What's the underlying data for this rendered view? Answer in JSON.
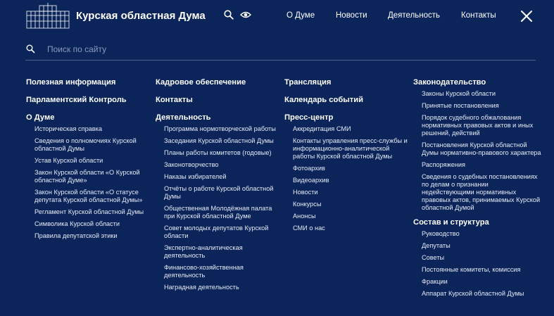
{
  "header": {
    "site_title": "Курская областная Дума",
    "nav": [
      "О Думе",
      "Новости",
      "Деятельность",
      "Контакты"
    ]
  },
  "search": {
    "placeholder": "Поиск по сайту"
  },
  "icons": {
    "search": "search-icon",
    "accessibility": "eye-icon",
    "close": "close-icon",
    "logo": "duma-building-logo"
  },
  "colors": {
    "background": "#0b2459",
    "text": "#ffffff",
    "divider": "#4a5f8c"
  },
  "columns": [
    {
      "sections": [
        {
          "title": "Полезная информация",
          "items": []
        },
        {
          "title": "Парламентский Контроль",
          "items": []
        },
        {
          "title": "О Думе",
          "items": [
            "Историческая справка",
            "Сведения о полномочиях Курской областной Думы",
            "Устав Курской области",
            "Закон Курской области «О Курской областной Думе»",
            "Закон Курской области «О статусе депутата Курской областной Думы»",
            "Регламент Курской областной Думы",
            "Символика Курской области",
            "Правила депутатской этики"
          ]
        }
      ]
    },
    {
      "sections": [
        {
          "title": "Кадровое обеспечение",
          "items": []
        },
        {
          "title": "Контакты",
          "items": []
        },
        {
          "title": "Деятельность",
          "items": [
            "Программа нормотворческой работы",
            "Заседания Курской областной Думы",
            "Планы работы комитетов (годовые)",
            "Законотворчество",
            "Наказы избирателей",
            "Отчёты о работе Курской областной Думы",
            "Общественная Молодёжная палата при Курской областной Думе",
            "Совет молодых депутатов Курской области",
            "Экспертно-аналитическая деятельность",
            "Финансово-хозяйственная деятельность",
            "Наградная деятельность"
          ]
        }
      ]
    },
    {
      "sections": [
        {
          "title": "Трансляция",
          "items": []
        },
        {
          "title": "Календарь событий",
          "items": []
        },
        {
          "title": "Пресс-центр",
          "items": [
            "Аккредитация СМИ",
            "Контакты управления пресс-службы и информационно-аналитической работы Курской областной Думы",
            "Фотоархив",
            "Видеоархив",
            "Новости",
            "Конкурсы",
            "Анонсы",
            "СМИ о нас"
          ]
        }
      ]
    },
    {
      "sections": [
        {
          "title": "Законодательство",
          "items": [
            "Законы Курской области",
            "Принятые постановления",
            "Порядок судебного обжалования нормативных правовых актов и иных решений, действий",
            "Постановления Курской областной Думы нормативно-правового характера",
            "Распоряжения",
            "Сведения о судебных постановлениях по делам о признании недействующими нормативных правовых актов, принимаемых Курской областной Думой"
          ]
        },
        {
          "title": "Состав и структура",
          "items": [
            "Руководство",
            "Депутаты",
            "Советы",
            "Постоянные комитеты, комиссия",
            "Фракции",
            "Аппарат Курской областной Думы"
          ]
        }
      ]
    }
  ]
}
